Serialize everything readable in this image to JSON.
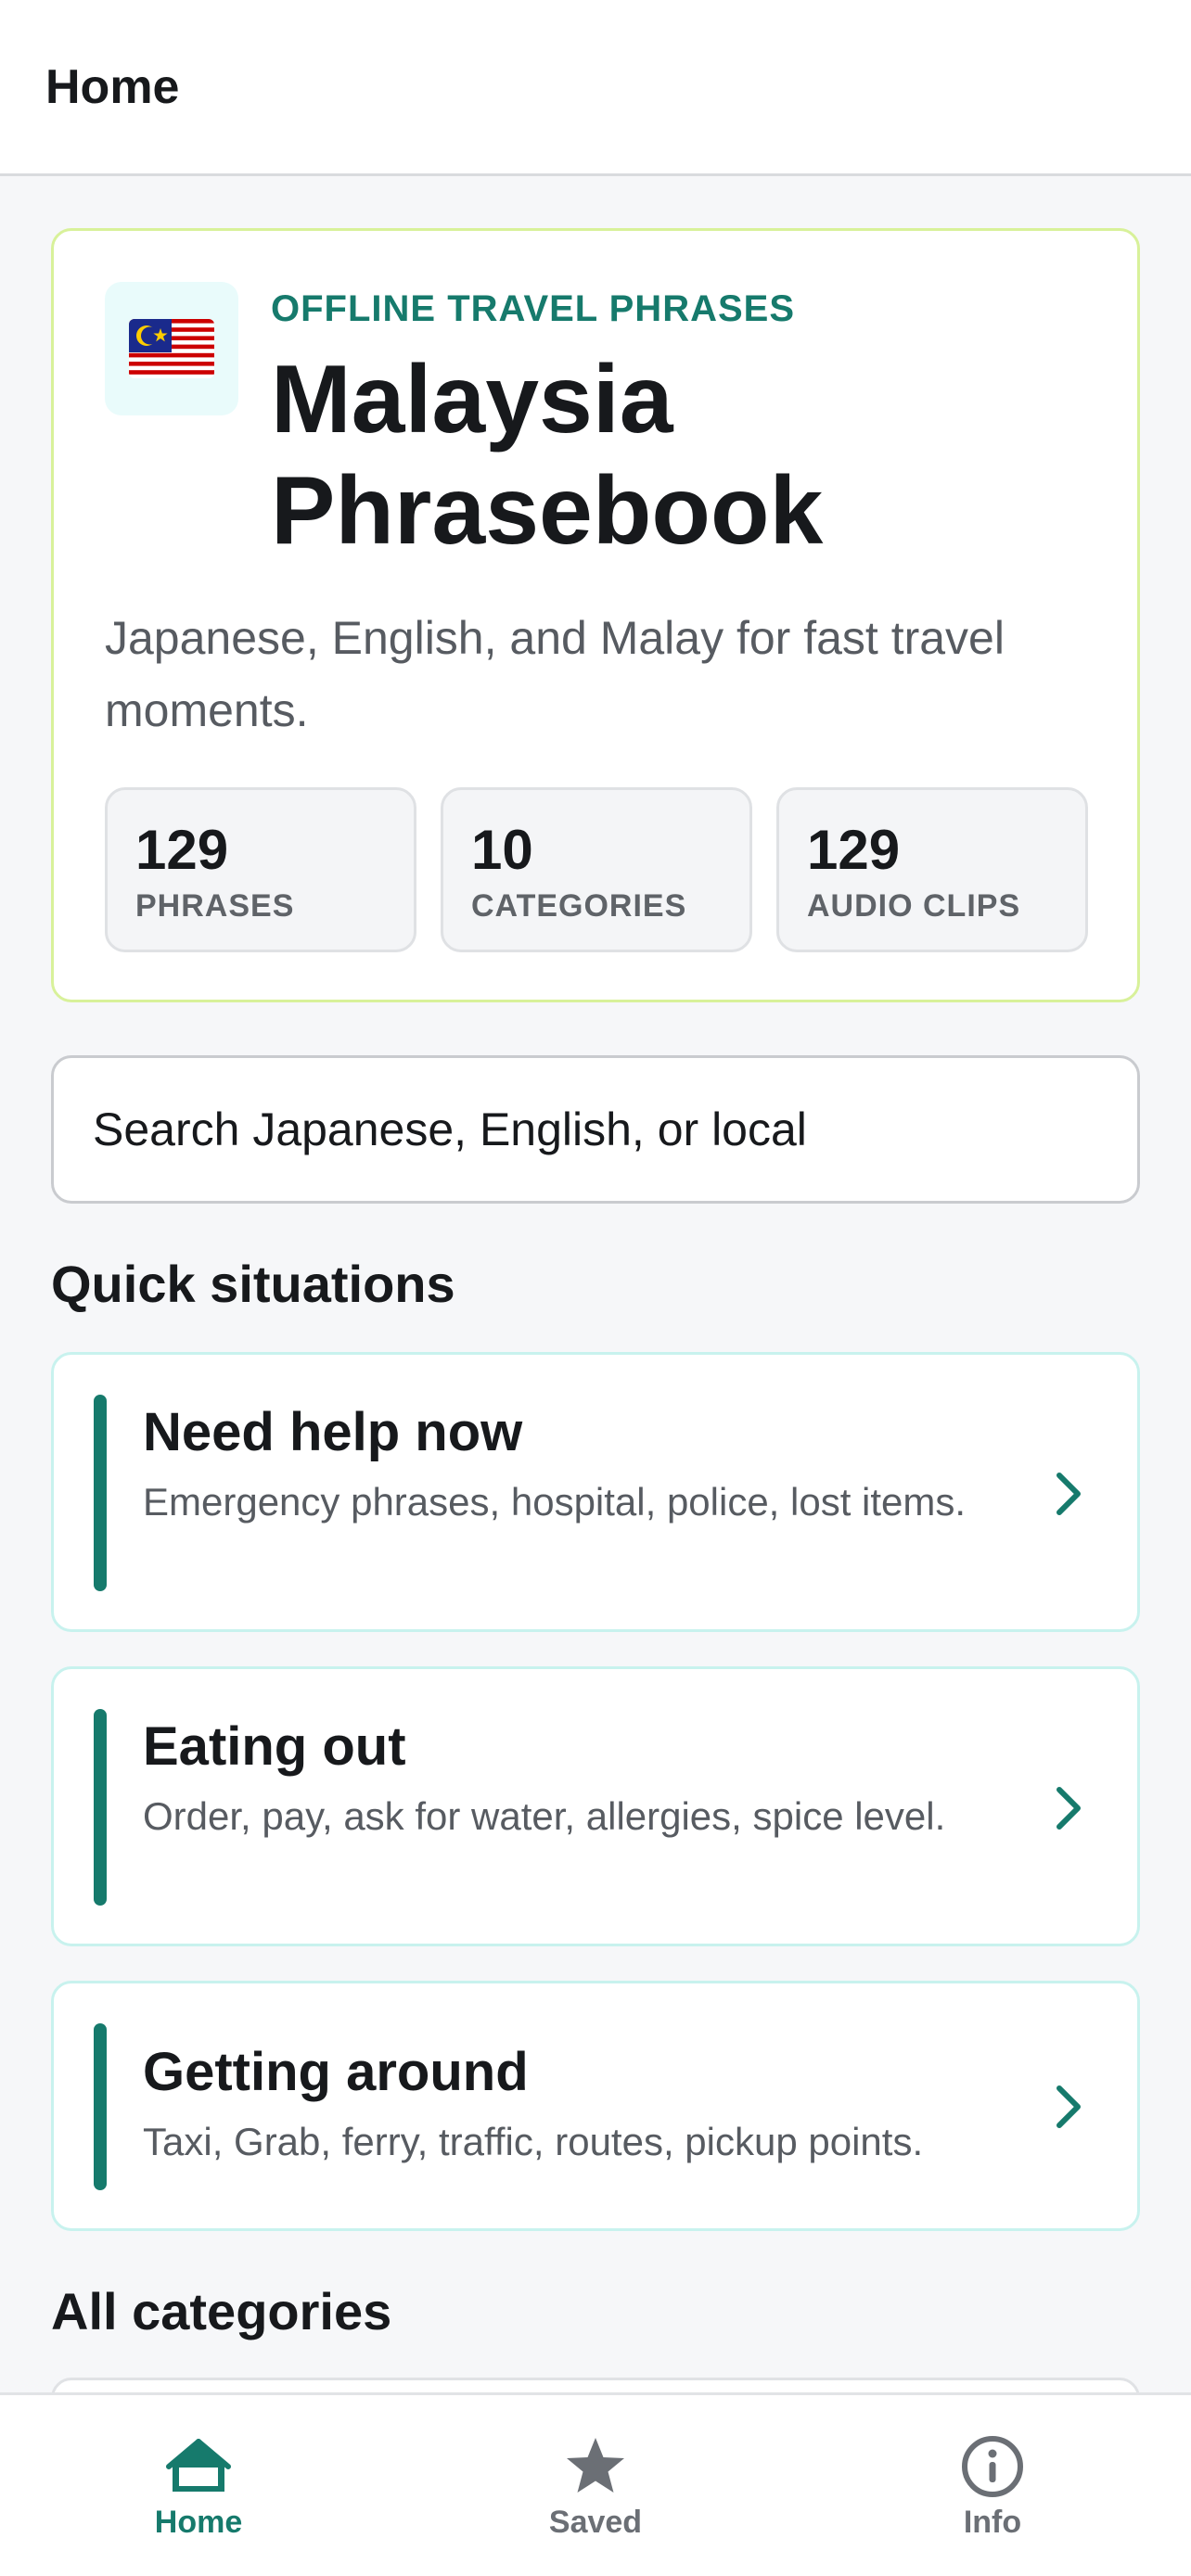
{
  "header": {
    "title": "Home"
  },
  "hero": {
    "flag_icon": "malaysia-flag-icon",
    "kicker": "OFFLINE TRAVEL PHRASES",
    "title": "Malaysia Phrasebook",
    "description": "Japanese, English, and Malay for fast travel moments.",
    "stats": [
      {
        "value": "129",
        "label": "PHRASES"
      },
      {
        "value": "10",
        "label": "CATEGORIES"
      },
      {
        "value": "129",
        "label": "AUDIO CLIPS"
      }
    ]
  },
  "search": {
    "placeholder": "Search Japanese, English, or local"
  },
  "quick": {
    "title": "Quick situations",
    "cards": [
      {
        "title": "Need help now",
        "subtitle": "Emergency phrases, hospital, police, lost items.",
        "icon": "chevron-right-icon"
      },
      {
        "title": "Eating out",
        "subtitle": "Order, pay, ask for water, allergies, spice level.",
        "icon": "chevron-right-icon"
      },
      {
        "title": "Getting around",
        "subtitle": "Taxi, Grab, ferry, traffic, routes, pickup points.",
        "icon": "chevron-right-icon"
      }
    ]
  },
  "categories": {
    "title": "All categories"
  },
  "tabs": [
    {
      "label": "Home",
      "icon": "home-icon",
      "active": true
    },
    {
      "label": "Saved",
      "icon": "star-icon",
      "active": false
    },
    {
      "label": "Info",
      "icon": "info-icon",
      "active": false
    }
  ],
  "colors": {
    "accent": "#167a6c",
    "inactive_tab": "#6b6f75",
    "hero_border": "#d8f19a",
    "card_border": "#c8f2ee"
  }
}
